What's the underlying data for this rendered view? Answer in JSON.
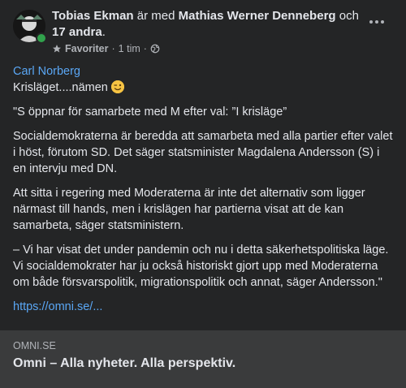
{
  "header": {
    "author": "Tobias Ekman",
    "with_text": " är med ",
    "tagged": "Mathias Werner Denneberg",
    "and_text": " och ",
    "others": "17 andra",
    "dot": ".",
    "audience": "Favoriter",
    "separator": "·",
    "time": "1 tim",
    "separator2": "·",
    "globe_icon": "globe-icon",
    "star_icon": "star-icon",
    "online_color": "#31a24c"
  },
  "post": {
    "quote_author": "Carl Norberg",
    "intro": "Krisläget....nämen",
    "emoji": "winking-face",
    "paragraphs": [
      "\"S öppnar för samarbete med M efter val: ”I krisläge”",
      "Socialdemokraterna är beredda att samarbeta med alla partier efter valet i höst, förutom SD. Det säger statsminister Magdalena Andersson (S) i en intervju med DN.",
      "Att sitta i regering med Moderaterna är inte det alternativ som ligger närmast till hands, men i krislägen har partierna visat att de kan samarbeta, säger statsministern.",
      "– Vi har visat det under pandemin och nu i detta säkerhetspolitiska läge. Vi socialdemokrater har ju också historiskt gjort upp med Moderaterna om både försvarspolitik, migrationspolitik och annat, säger Andersson.\""
    ],
    "link": "https://omni.se/..."
  },
  "preview": {
    "domain": "OMNI.SE",
    "title": "Omni – Alla nyheter. Alla perspektiv."
  }
}
